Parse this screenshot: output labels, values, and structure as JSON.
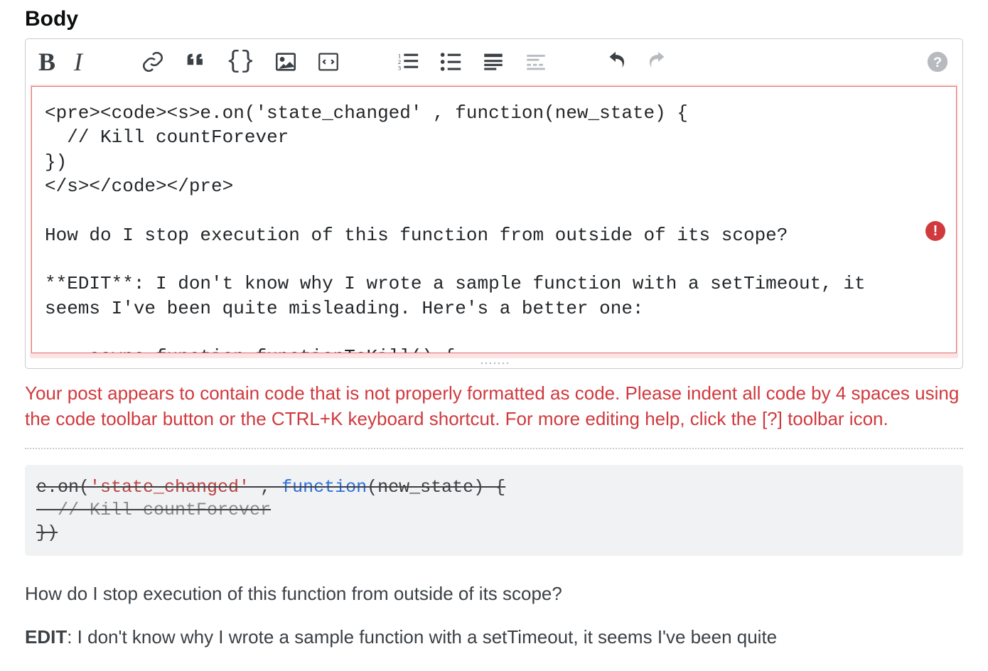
{
  "label": "Body",
  "toolbar": {
    "bold_label": "B",
    "italic_label": "I",
    "code_label": "{}"
  },
  "editor": {
    "content": "<pre><code><s>e.on('state_changed' , function(new_state) {\n  // Kill countForever\n})\n</s></code></pre>\n\nHow do I stop execution of this function from outside of its scope?\n\n**EDIT**: I don't know why I wrote a sample function with a setTimeout, it seems I've been quite misleading. Here's a better one:\n\n    async function functionToKill() {",
    "error_badge": "!"
  },
  "error_message": "Your post appears to contain code that is not properly formatted as code. Please indent all code by 4 spaces using the code toolbar button or the CTRL+K keyboard shortcut. For more editing help, click the [?] toolbar icon.",
  "preview": {
    "code_line1_a": "e.on(",
    "code_line1_b": "'state_changed'",
    "code_line1_c": " , ",
    "code_line1_d": "function",
    "code_line1_e": "(new_state) {",
    "code_line2": "  // Kill countForever",
    "code_line3": "})",
    "para1": "How do I stop execution of this function from outside of its scope?",
    "edit_label": "EDIT",
    "para2_rest": ": I don't know why I wrote a sample function with a setTimeout, it seems I've been quite"
  }
}
